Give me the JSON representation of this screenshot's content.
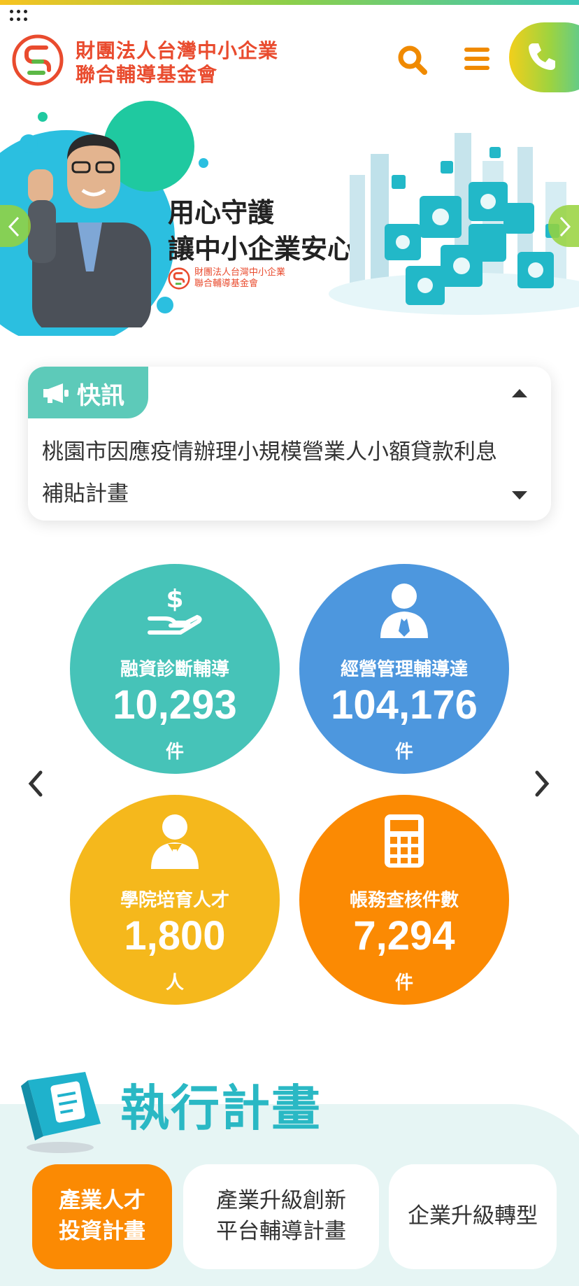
{
  "header": {
    "org_name_line1": "財團法人台灣中小企業",
    "org_name_line2": "聯合輔導基金會",
    "logo_icon": "smeg-logo-icon",
    "search_icon": "search-icon",
    "menu_icon": "hamburger-menu-icon",
    "phone_icon": "phone-icon"
  },
  "banner": {
    "slogan_line1": "用心守護",
    "slogan_line2": "讓中小企業安心",
    "logo_line1": "財團法人台灣中小企業",
    "logo_line2": "聯合輔導基金會"
  },
  "news": {
    "tag": "快訊",
    "headline": "桃園市因應疫情辦理小規模營業人小額貸款利息補貼計畫"
  },
  "stats": [
    {
      "label": "融資診斷輔導",
      "value": "10,293",
      "unit": "件",
      "icon": "money-hand-icon",
      "color": "#46c3b8"
    },
    {
      "label": "經營管理輔導達",
      "value": "104,176",
      "unit": "件",
      "icon": "consultant-icon",
      "color": "#4d97de"
    },
    {
      "label": "學院培育人才",
      "value": "1,800",
      "unit": "人",
      "icon": "person-icon",
      "color": "#f5b81c"
    },
    {
      "label": "帳務查核件數",
      "value": "7,294",
      "unit": "件",
      "icon": "calculator-icon",
      "color": "#fb8a03"
    }
  ],
  "projects": {
    "title": "執行計畫",
    "tabs": [
      {
        "line1": "產業人才",
        "line2": "投資計畫",
        "active": true
      },
      {
        "line1": "產業升級創新",
        "line2": "平台輔導計畫",
        "active": false
      },
      {
        "line1": "企業升級轉型",
        "line2": "",
        "active": false
      }
    ]
  }
}
